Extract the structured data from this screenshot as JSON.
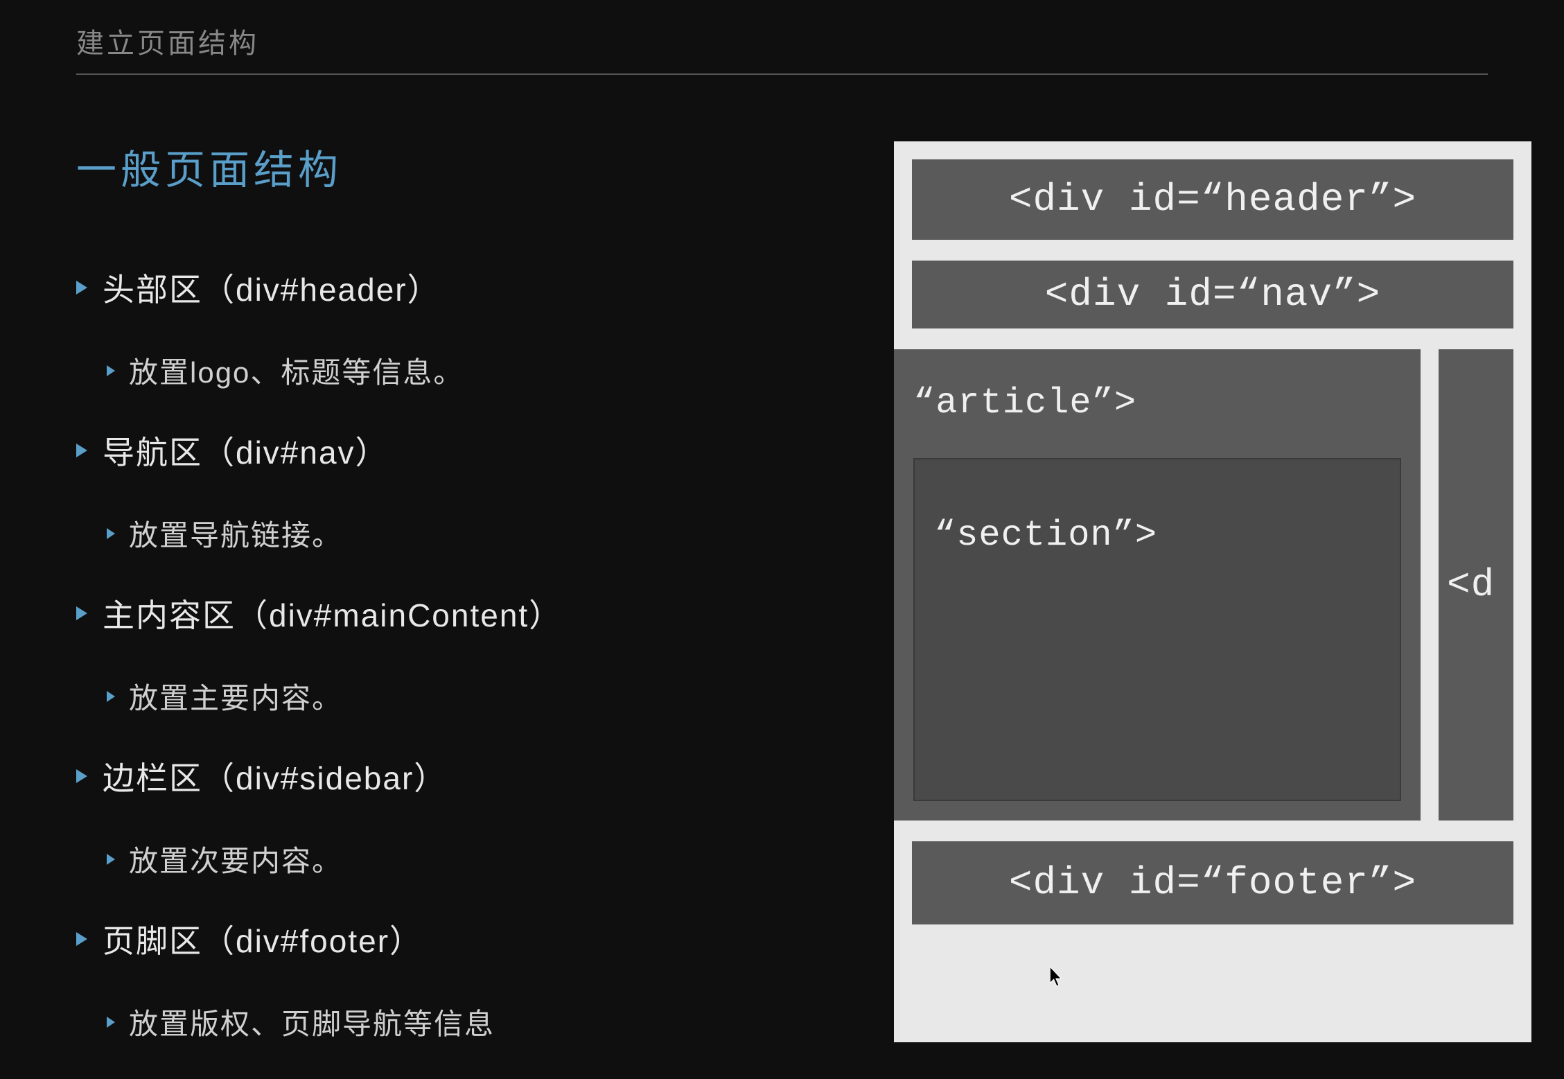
{
  "slide": {
    "title": "建立页面结构",
    "section_heading": "一般页面结构",
    "bullets": [
      {
        "label_pre": "头部区（",
        "code": "div#header",
        "label_post": "）",
        "sub": "放置logo、标题等信息。"
      },
      {
        "label_pre": "导航区（",
        "code": "div#nav",
        "label_post": "）",
        "sub": "放置导航链接。"
      },
      {
        "label_pre": "主内容区（",
        "code": "div#mainContent",
        "label_post": "）",
        "sub": "放置主要内容。"
      },
      {
        "label_pre": "边栏区（",
        "code": "div#sidebar",
        "label_post": "）",
        "sub": "放置次要内容。"
      },
      {
        "label_pre": "页脚区（",
        "code": "div#footer",
        "label_post": "）",
        "sub": "放置版权、页脚导航等信息"
      }
    ],
    "diagram": {
      "header": "<div id=“header”>",
      "nav": "<div id=“nav”>",
      "article": "“article”>",
      "section": "“section”>",
      "sidebar": "<d",
      "footer": "<div id=“footer”>"
    }
  }
}
